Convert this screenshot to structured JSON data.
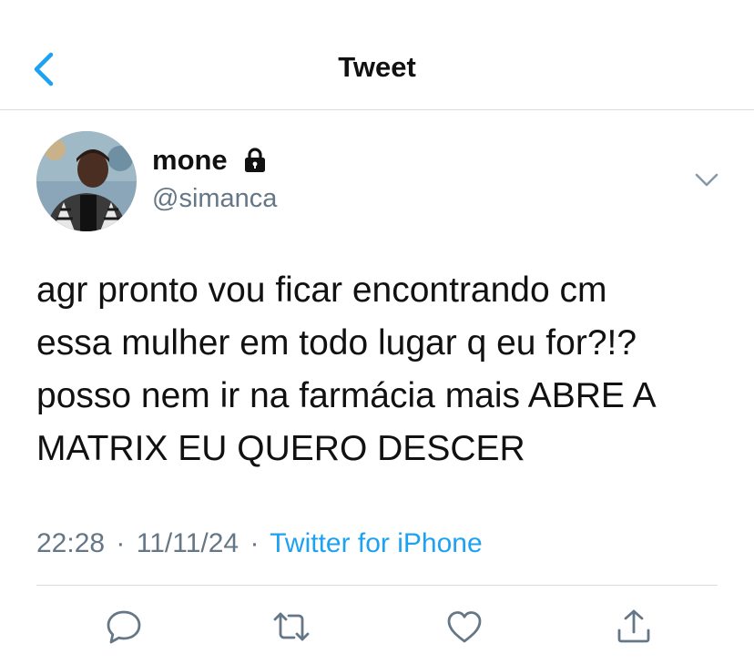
{
  "header": {
    "title": "Tweet"
  },
  "user": {
    "display_name": "mone",
    "handle": "@simanca"
  },
  "tweet": {
    "lines": [
      "agr pronto vou ficar encontrando cm",
      "essa mulher em todo lugar q eu for?!?",
      "posso nem ir na farmácia mais ABRE A",
      "MATRIX EU QUERO DESCER"
    ],
    "time": "22:28",
    "date": "11/11/24",
    "separator": "·",
    "source": "Twitter for iPhone"
  },
  "icons": {
    "back": "chevron-left-icon",
    "lock": "lock-icon",
    "more": "chevron-down-icon",
    "reply": "reply-icon",
    "retweet": "retweet-icon",
    "like": "heart-icon",
    "share": "share-icon"
  },
  "colors": {
    "accent": "#1da1f2",
    "secondary_text": "#657786",
    "divider": "#d8dde1"
  }
}
